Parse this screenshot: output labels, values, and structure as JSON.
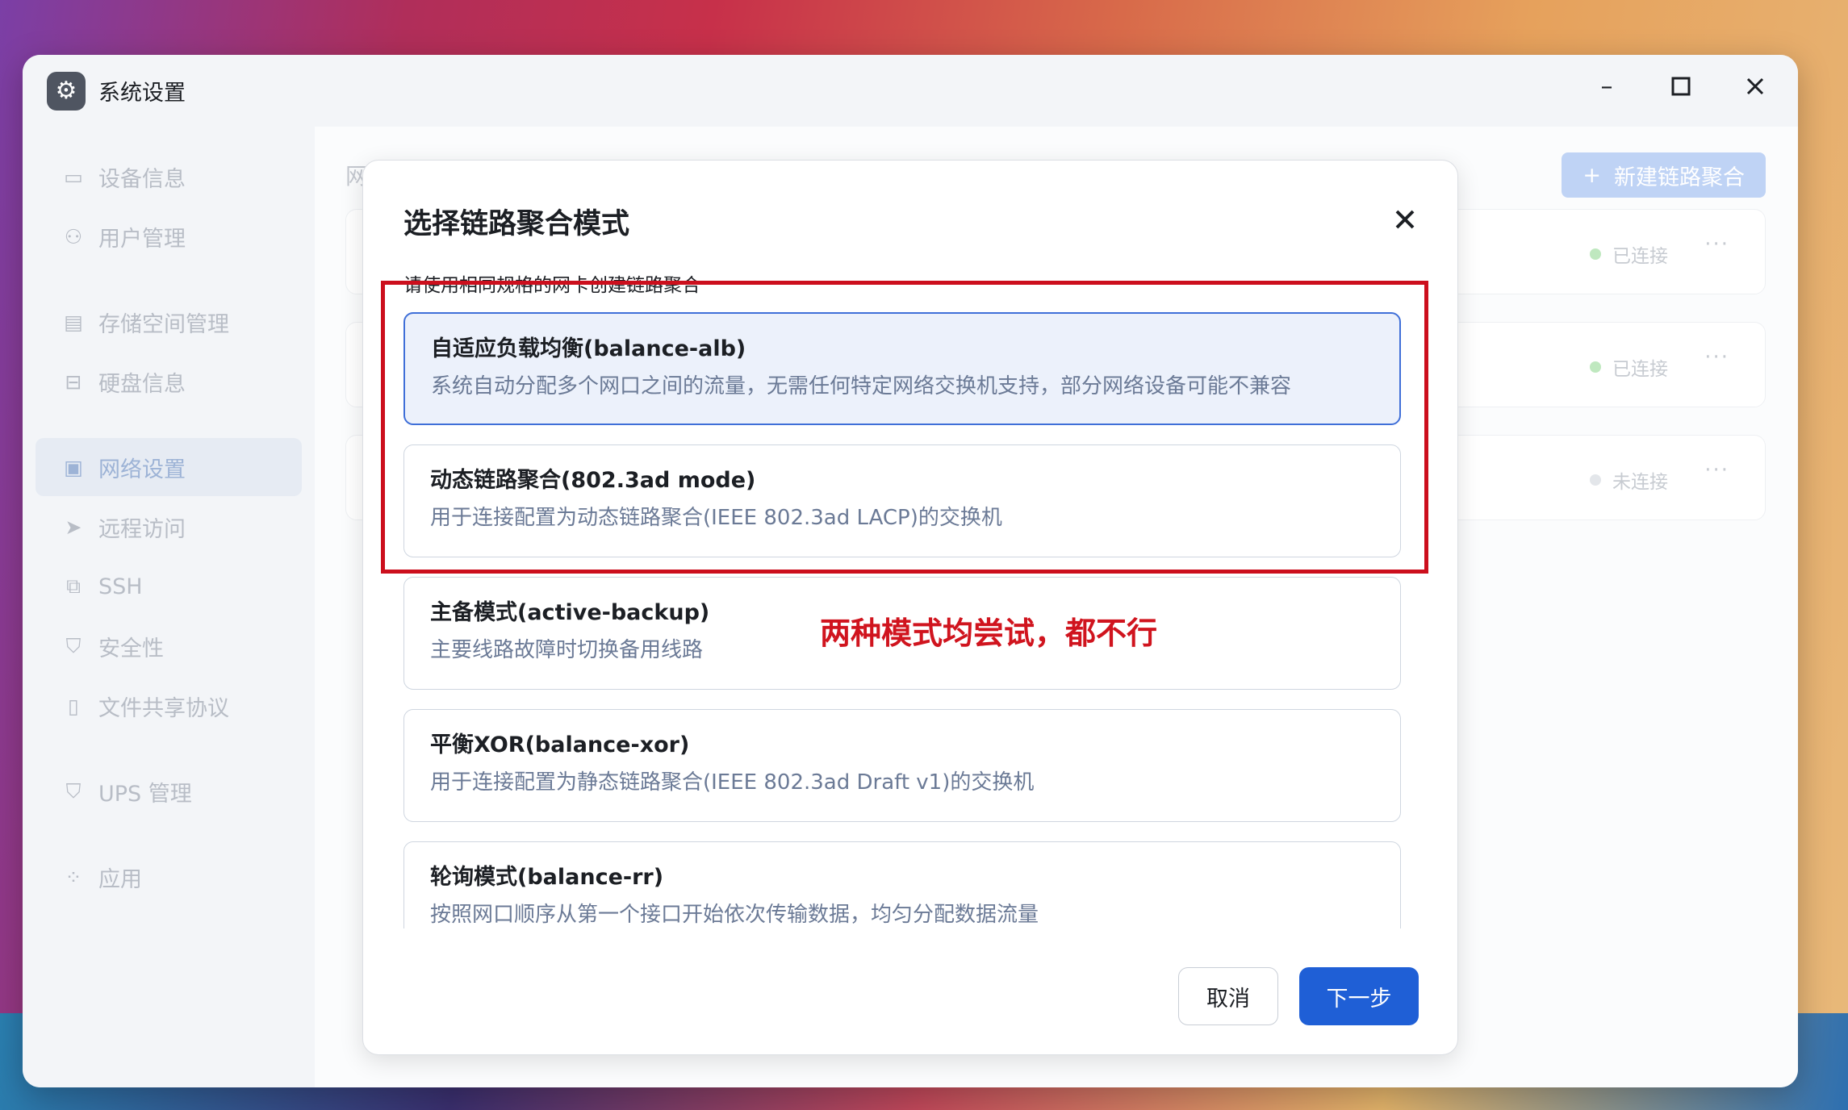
{
  "window": {
    "title": "系统设置"
  },
  "sidebar": {
    "items": [
      {
        "label": "设备信息",
        "icon": "device-icon"
      },
      {
        "label": "用户管理",
        "icon": "user-icon"
      },
      {
        "label": "存储空间管理",
        "icon": "storage-icon"
      },
      {
        "label": "硬盘信息",
        "icon": "disk-icon"
      },
      {
        "label": "网络设置",
        "icon": "network-icon",
        "active": true
      },
      {
        "label": "远程访问",
        "icon": "send-icon"
      },
      {
        "label": "SSH",
        "icon": "code-icon"
      },
      {
        "label": "安全性",
        "icon": "shield-icon"
      },
      {
        "label": "文件共享协议",
        "icon": "file-icon"
      },
      {
        "label": "UPS 管理",
        "icon": "ups-shield-icon"
      },
      {
        "label": "应用",
        "icon": "apps-icon"
      }
    ]
  },
  "main": {
    "title_partial": "网",
    "new_button": "新建链路聚合",
    "rows": [
      {
        "status": "已连接",
        "status_color": "#7cd67c",
        "more": "···"
      },
      {
        "status": "已连接",
        "status_color": "#7cd67c",
        "more": "···"
      },
      {
        "status": "未连接",
        "status_color": "#c9ced6",
        "more": "···"
      }
    ]
  },
  "modal": {
    "title": "选择链路聚合模式",
    "hint": "请使用相同规格的网卡创建链路聚合",
    "options": [
      {
        "title": "自适应负载均衡(balance-alb)",
        "desc": "系统自动分配多个网口之间的流量，无需任何特定网络交换机支持，部分网络设备可能不兼容",
        "selected": true
      },
      {
        "title": "动态链路聚合(802.3ad mode)",
        "desc": "用于连接配置为动态链路聚合(IEEE 802.3ad LACP)的交换机"
      },
      {
        "title": "主备模式(active-backup)",
        "desc": "主要线路故障时切换备用线路"
      },
      {
        "title": "平衡XOR(balance-xor)",
        "desc": "用于连接配置为静态链路聚合(IEEE 802.3ad Draft v1)的交换机"
      },
      {
        "title": "轮询模式(balance-rr)",
        "desc": "按照网口顺序从第一个接口开始依次传输数据，均匀分配数据流量"
      }
    ],
    "cancel": "取消",
    "next": "下一步"
  },
  "annotation": {
    "text": "两种模式均尝试，都不行",
    "color": "#d0141e"
  }
}
